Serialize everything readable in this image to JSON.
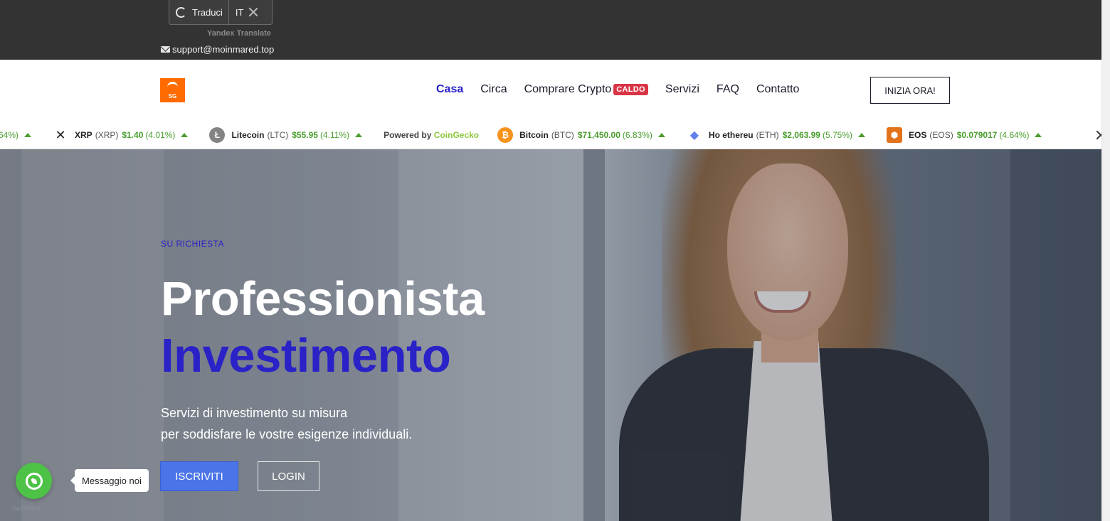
{
  "topbar": {
    "translate_label": "Traduci",
    "translate_lang": "IT",
    "translate_provider": "Yandex Translate",
    "email": "support@moinmared.top"
  },
  "header": {
    "logo_text": "SG",
    "nav": [
      {
        "label": "Casa",
        "active": true
      },
      {
        "label": "Circa",
        "active": false
      },
      {
        "label": "Comprare Crypto",
        "badge": "CALDO"
      },
      {
        "label": "Servizi",
        "active": false
      },
      {
        "label": "FAQ",
        "active": false
      },
      {
        "label": "Contatto",
        "active": false
      }
    ],
    "cta": "INIZIA ORA!"
  },
  "ticker": {
    "partial_change": "64%)",
    "items_before": [
      {
        "name": "XRP",
        "symbol": "(XRP)",
        "price": "$1.40",
        "change": "(4.01%)",
        "icon": "xrp-icon",
        "color": "#222222"
      },
      {
        "name": "Litecoin",
        "symbol": "(LTC)",
        "price": "$55.95",
        "change": "(4.11%)",
        "icon": "litecoin-icon",
        "color": "#838383"
      }
    ],
    "powered_by": "Powered by",
    "powered_brand": "CoinGecko",
    "items_after": [
      {
        "name": "Bitcoin",
        "symbol": "(BTC)",
        "price": "$71,450.00",
        "change": "(6.83%)",
        "icon": "bitcoin-icon",
        "color": "#f7931a"
      },
      {
        "name": "Ho ethereu",
        "symbol": "(ETH)",
        "price": "$2,063.99",
        "change": "(5.75%)",
        "icon": "ethereum-icon",
        "color": "#627eea"
      },
      {
        "name": "EOS",
        "symbol": "(EOS)",
        "price": "$0.079017",
        "change": "(4.64%)",
        "icon": "eos-icon",
        "color": "#e2731b"
      }
    ]
  },
  "hero": {
    "eyebrow": "SU RICHIESTA",
    "title_line1": "Professionista",
    "title_line2": "Investimento",
    "subtitle_line1": "Servizi di investimento su misura",
    "subtitle_line2": "per soddisfare le vostre esigenze individuali.",
    "primary_button": "ISCRIVITI",
    "secondary_button": "LOGIN"
  },
  "whatsapp": {
    "tooltip": "Messaggio noi",
    "credit": "GetButton"
  },
  "colors": {
    "accent": "#2a22c7",
    "topbar": "#333333",
    "up": "#4a9d2e",
    "badge": "#d93545",
    "button": "#4a74e8",
    "whatsapp": "#4dc247"
  }
}
